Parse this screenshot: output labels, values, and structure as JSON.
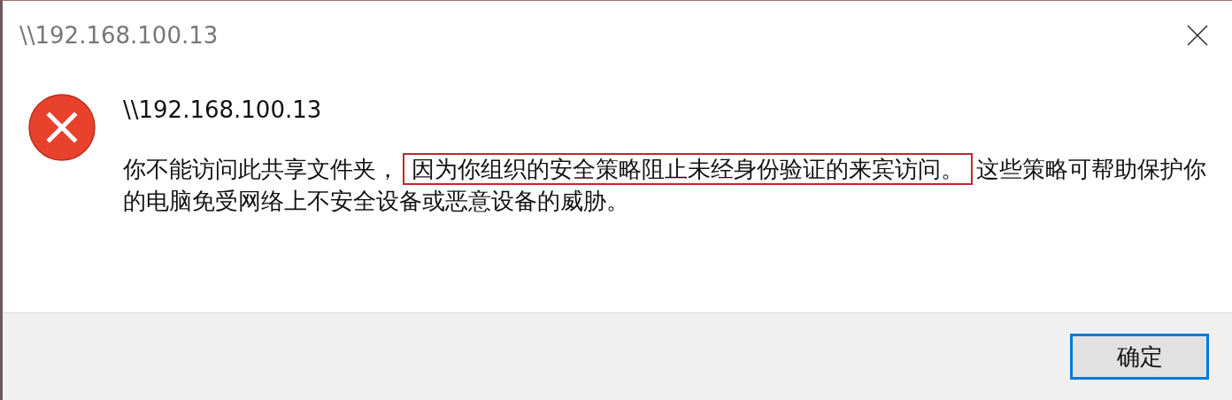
{
  "window": {
    "title": "\\\\192.168.100.13"
  },
  "heading": "\\\\192.168.100.13",
  "message": [
    {
      "text": "你不能访问此共享文件夹，",
      "highlighted": false
    },
    {
      "text": "因为你组织的安全策略阻止未经身份验证的来宾访问。",
      "highlighted": true
    },
    {
      "text": "这些策略可帮助保护你的电脑免受网络上不安全设备或恶意设备的威胁。",
      "highlighted": false
    }
  ],
  "buttons": [
    {
      "label": "确定",
      "focused": true
    }
  ]
}
